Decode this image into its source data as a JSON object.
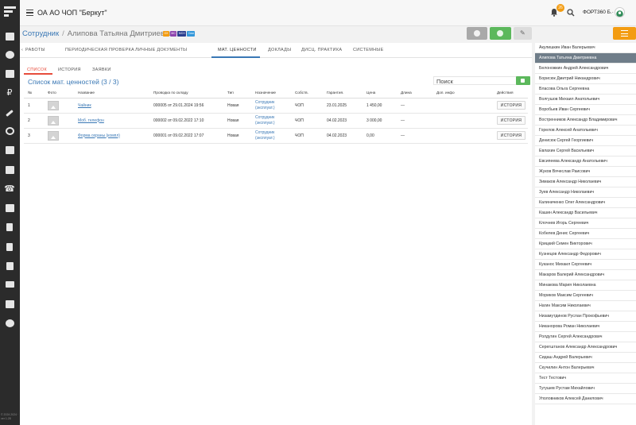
{
  "app": {
    "org_name": "ОА АО ЧОП \"Беркут\"",
    "notifications_count": "26",
    "user_name": "ФОРТ360 Б.·",
    "version_text": "© 2024 2024 · ver 1.28"
  },
  "header": {
    "breadcrumb_root": "Сотрудник",
    "breadcrumb_sep": "/",
    "employee_name": "Алипова Татьяна Дмитриевна",
    "chips": [
      {
        "label": "ОХ",
        "color": "#f39c12"
      },
      {
        "label": "МС",
        "color": "#8e44ad"
      },
      {
        "label": "МСН",
        "color": "#2c3e8f"
      },
      {
        "label": "Сим",
        "color": "#3498db"
      }
    ]
  },
  "tabs": [
    "РАБОТЫ",
    "ПЕРИОДИЧЕСКАЯ ПРОВЕРКА",
    "ЛИЧНЫЕ ДОКУМЕНТЫ",
    "МАТ. ЦЕННОСТИ",
    "ДОКЛАДЫ",
    "ДИСЦ. ПРАКТИКА",
    "СИСТЕМНЫЕ"
  ],
  "tab_back_arrow": "‹",
  "subtabs": [
    "СПИСОК",
    "ИСТОРИЯ",
    "ЗАЯВКИ"
  ],
  "list": {
    "title": "Список мат. ценностей (3 / 3)",
    "search_placeholder": "Поиск"
  },
  "table": {
    "columns": [
      "№",
      "Фото",
      "Название",
      "Проводка по складу",
      "Тип",
      "Назначение",
      "Собств.",
      "Гарантия.",
      "Цена",
      "Длина",
      "Доп. инфо",
      "Действия"
    ],
    "rows": [
      {
        "n": "1",
        "name": "Чайник",
        "posting": "000005 от 29.01.2024 19:56",
        "type": "Новая",
        "purpose_1": "Сотрудник",
        "purpose_2": "(эксплуат.)",
        "owner": "ЧОП",
        "warranty": "23.01.2025",
        "price": "1 450,00",
        "length": "—",
        "info": "",
        "action": "ИСТОРИЯ"
      },
      {
        "n": "2",
        "name": "Моб. телефон",
        "posting": "000002 от 09.02.2022 17:10",
        "type": "Новая",
        "purpose_1": "Сотрудник",
        "purpose_2": "(эксплуат.)",
        "owner": "ЧОП",
        "warranty": "04.02.2023",
        "price": "3 000,00",
        "length": "—",
        "info": "",
        "action": "ИСТОРИЯ"
      },
      {
        "n": "3",
        "name": "Форма охраны (компл)",
        "posting": "000001 от 09.02.2022 17:07",
        "type": "Новая",
        "purpose_1": "Сотрудник",
        "purpose_2": "(эксплуат.)",
        "owner": "ЧОП",
        "warranty": "04.02.2023",
        "price": "0,00",
        "length": "—",
        "info": "",
        "action": "ИСТОРИЯ"
      }
    ]
  },
  "employees": [
    "Акулишкин Иван Валерьевич",
    "Алипова Татьяна Дмитриевна",
    "Белоножкин Андрей Александрович",
    "Борисюк Дмитрий Никандрович",
    "Власова Ольга Сергеевна",
    "Волгушов Михаил Анатольевич",
    "Воробьев Иван Сергеевич",
    "Востренников Александр Владимирович",
    "Горелов Алексей Анатольевич",
    "Денисюк Сергей Георгиевич",
    "Евлахин Сергей Васильевич",
    "Евсипеева Александр Анатольевич",
    "Жуков Вячеслав Раисович",
    "Зимаков Александр Николаевич",
    "Зуев Александр Николаевич",
    "Калиниченко Олег Александрович",
    "Кашин Александр Васильевич",
    "Клочнев Игорь Сергеевич",
    "Кобелев Денис Сергеевич",
    "Крицкий Семен Викторович",
    "Кузнецов Александр Федорович",
    "Куканос Михаил Сергеевич",
    "Макаров Валерий Александрович",
    "Минакова Мария Николаевна",
    "Мориков Максим Сергеевич",
    "Нагин Максим Николаевич",
    "Низамутдинов Руслан Прокофьевич",
    "Никанорова Роман Николаевич",
    "Ролдугин Сергей Александрович",
    "Серегштанов Александр Александрович",
    "Сидаш Андрей Валерьевич",
    "Скучилин Антон Валерьевич",
    "Тест Тестович",
    "Тугушев Рустам Михайлович",
    "Уполовников Алексей Данилович"
  ],
  "selected_employee_index": 1,
  "colors": {
    "accent": "#3a78b5",
    "orange": "#f39c12",
    "green": "#5cb85c",
    "selected": "#6f7d89",
    "active_subtab": "#e74c3c"
  }
}
